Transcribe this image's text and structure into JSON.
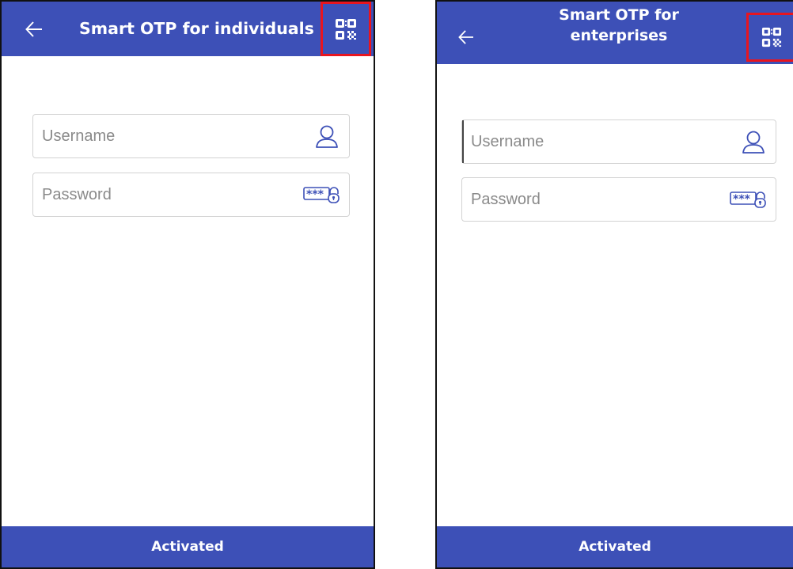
{
  "screens": [
    {
      "title": "Smart OTP for individuals",
      "back_icon": "arrow-left-icon",
      "qr_icon": "qr-code-icon",
      "username_placeholder": "Username",
      "password_placeholder": "Password",
      "user_icon": "user-icon",
      "password_icon": "password-lock-icon",
      "bottom_button": "Activated"
    },
    {
      "title": "Smart OTP for enterprises",
      "back_icon": "arrow-left-icon",
      "qr_icon": "qr-code-icon",
      "username_placeholder": "Username",
      "password_placeholder": "Password",
      "user_icon": "user-icon",
      "password_icon": "password-lock-icon",
      "bottom_button": "Activated"
    }
  ],
  "colors": {
    "primary": "#3d50b7",
    "highlight": "#e8151f",
    "field_border": "#d3d3d3",
    "icon": "#3d50b7"
  }
}
